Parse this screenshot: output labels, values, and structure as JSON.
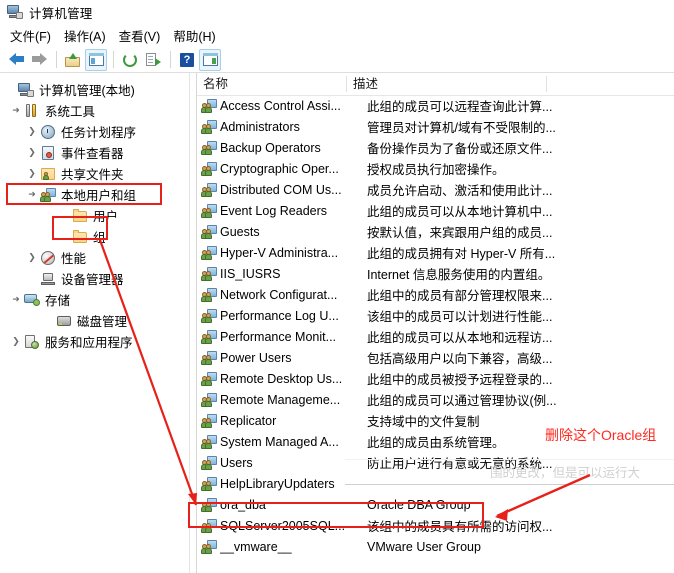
{
  "window": {
    "title": "计算机管理",
    "app_icon": "computer-management-icon"
  },
  "menu": {
    "items": [
      {
        "label": "文件(F)",
        "name": "menu-file"
      },
      {
        "label": "操作(A)",
        "name": "menu-action"
      },
      {
        "label": "查看(V)",
        "name": "menu-view"
      },
      {
        "label": "帮助(H)",
        "name": "menu-help"
      }
    ]
  },
  "toolbar": {
    "buttons": [
      {
        "icon": "back-arrow-icon",
        "pressed": false
      },
      {
        "icon": "forward-arrow-icon",
        "pressed": false
      },
      {
        "icon": "up-one-level-folder-icon",
        "pressed": false
      },
      {
        "icon": "show-hide-console-tree-icon",
        "pressed": true
      },
      {
        "icon": "refresh-icon",
        "pressed": false
      },
      {
        "icon": "export-list-icon",
        "pressed": false
      },
      {
        "icon": "help-icon",
        "pressed": false
      },
      {
        "icon": "show-hide-action-pane-icon",
        "pressed": true
      }
    ]
  },
  "tree": {
    "nodes": [
      {
        "label": "计算机管理(本地)",
        "icon": "computer-management-icon",
        "indent": 0,
        "expander": "expanded-hidden",
        "name": "tree-node-computer-management"
      },
      {
        "label": "系统工具",
        "icon": "system-tools-icon",
        "indent": 1,
        "expander": "expanded",
        "name": "tree-node-system-tools"
      },
      {
        "label": "任务计划程序",
        "icon": "task-scheduler-icon",
        "indent": 2,
        "expander": "collapsed",
        "name": "tree-node-task-scheduler"
      },
      {
        "label": "事件查看器",
        "icon": "event-viewer-icon",
        "indent": 2,
        "expander": "collapsed",
        "name": "tree-node-event-viewer"
      },
      {
        "label": "共享文件夹",
        "icon": "shared-folders-icon",
        "indent": 2,
        "expander": "collapsed",
        "name": "tree-node-shared-folders"
      },
      {
        "label": "本地用户和组",
        "icon": "local-users-and-groups-icon",
        "indent": 2,
        "expander": "expanded",
        "name": "tree-node-local-users-and-groups"
      },
      {
        "label": "用户",
        "icon": "folder-icon",
        "indent": 3,
        "expander": "none",
        "name": "tree-node-users"
      },
      {
        "label": "组",
        "icon": "folder-icon",
        "indent": 3,
        "expander": "none",
        "name": "tree-node-groups"
      },
      {
        "label": "性能",
        "icon": "performance-icon",
        "indent": 2,
        "expander": "collapsed",
        "name": "tree-node-performance"
      },
      {
        "label": "设备管理器",
        "icon": "device-manager-icon",
        "indent": 2,
        "expander": "none",
        "name": "tree-node-device-manager"
      },
      {
        "label": "存储",
        "icon": "storage-icon",
        "indent": 1,
        "expander": "expanded",
        "name": "tree-node-storage"
      },
      {
        "label": "磁盘管理",
        "icon": "disk-management-icon",
        "indent": 2,
        "expander": "none",
        "name": "tree-node-disk-management"
      },
      {
        "label": "服务和应用程序",
        "icon": "services-and-applications-icon",
        "indent": 1,
        "expander": "collapsed",
        "name": "tree-node-services-and-applications"
      }
    ]
  },
  "list": {
    "columns": [
      {
        "label": "名称",
        "name": "column-header-name"
      },
      {
        "label": "描述",
        "name": "column-header-description"
      }
    ],
    "rows": [
      {
        "name": "Access Control Assi...",
        "description": "此组的成员可以远程查询此计算..."
      },
      {
        "name": "Administrators",
        "description": "管理员对计算机/域有不受限制的..."
      },
      {
        "name": "Backup Operators",
        "description": "备份操作员为了备份或还原文件..."
      },
      {
        "name": "Cryptographic Oper...",
        "description": "授权成员执行加密操作。"
      },
      {
        "name": "Distributed COM Us...",
        "description": "成员允许启动、激活和使用此计..."
      },
      {
        "name": "Event Log Readers",
        "description": "此组的成员可以从本地计算机中..."
      },
      {
        "name": "Guests",
        "description": "按默认值，来宾跟用户组的成员..."
      },
      {
        "name": "Hyper-V Administra...",
        "description": "此组的成员拥有对 Hyper-V 所有..."
      },
      {
        "name": "IIS_IUSRS",
        "description": "Internet 信息服务使用的内置组。"
      },
      {
        "name": "Network Configurat...",
        "description": "此组中的成员有部分管理权限来..."
      },
      {
        "name": "Performance Log U...",
        "description": "该组中的成员可以计划进行性能..."
      },
      {
        "name": "Performance Monit...",
        "description": "此组的成员可以从本地和远程访..."
      },
      {
        "name": "Power Users",
        "description": "包括高级用户以向下兼容，高级..."
      },
      {
        "name": "Remote Desktop Us...",
        "description": "此组中的成员被授予远程登录的..."
      },
      {
        "name": "Remote Manageme...",
        "description": "此组的成员可以通过管理协议(例..."
      },
      {
        "name": "Replicator",
        "description": "支持域中的文件复制"
      },
      {
        "name": "System Managed A...",
        "description": "此组的成员由系统管理。"
      },
      {
        "name": "Users",
        "description": "防止用户进行有意或无意的系统..."
      },
      {
        "name": "HelpLibraryUpdaters",
        "description": ""
      },
      {
        "name": "ora_dba",
        "description": "Oracle DBA Group"
      },
      {
        "name": "SQLServer2005SQL...",
        "description": "该组中的成员具有所需的访问权..."
      },
      {
        "name": "__vmware__",
        "description": "VMware User Group"
      }
    ]
  },
  "tooltip_ghost": {
    "text": "围的更改，但是可以运行大"
  },
  "annotations": {
    "color": "#e8201a",
    "text_color": "#ff2a20",
    "callout": "删除这个Oracle组",
    "boxes": [
      {
        "name": "highlight-local-users-and-groups"
      },
      {
        "name": "highlight-groups-node"
      },
      {
        "name": "highlight-ora-dba-row"
      }
    ],
    "arrows": [
      {
        "name": "arrow-groups-to-ora-dba"
      },
      {
        "name": "arrow-callout-to-ora-dba"
      }
    ]
  }
}
